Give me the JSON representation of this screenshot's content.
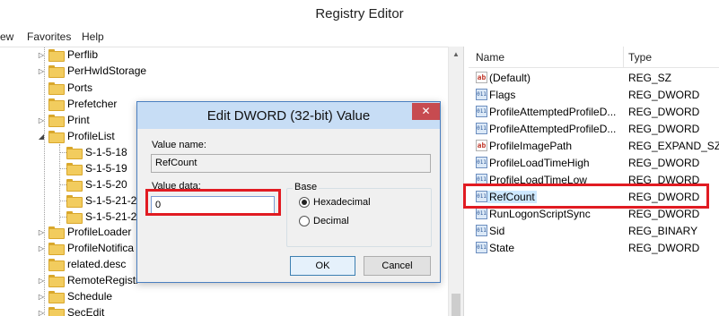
{
  "window": {
    "title": "Registry Editor"
  },
  "menu": {
    "items": [
      "ew",
      "Favorites",
      "Help"
    ]
  },
  "tree": {
    "items": [
      {
        "label": "Perflib",
        "arrow": "▷"
      },
      {
        "label": "PerHwIdStorage",
        "arrow": "▷"
      },
      {
        "label": "Ports",
        "arrow": ""
      },
      {
        "label": "Prefetcher",
        "arrow": ""
      },
      {
        "label": "Print",
        "arrow": "▷"
      },
      {
        "label": "ProfileList",
        "arrow": "◢"
      },
      {
        "label": "S-1-5-18",
        "arrow": ""
      },
      {
        "label": "S-1-5-19",
        "arrow": ""
      },
      {
        "label": "S-1-5-20",
        "arrow": ""
      },
      {
        "label": "S-1-5-21-2",
        "arrow": ""
      },
      {
        "label": "S-1-5-21-2",
        "arrow": ""
      },
      {
        "label": "ProfileLoader",
        "arrow": "▷"
      },
      {
        "label": "ProfileNotifica",
        "arrow": "▷"
      },
      {
        "label": "related.desc",
        "arrow": ""
      },
      {
        "label": "RemoteRegistr",
        "arrow": "▷"
      },
      {
        "label": "Schedule",
        "arrow": "▷"
      },
      {
        "label": "SecEdit",
        "arrow": "▷"
      }
    ]
  },
  "values": {
    "columns": {
      "name": "Name",
      "type": "Type"
    },
    "rows": [
      {
        "name": "(Default)",
        "type": "REG_SZ",
        "icon": "ab"
      },
      {
        "name": "Flags",
        "type": "REG_DWORD",
        "icon": "bin"
      },
      {
        "name": "ProfileAttemptedProfileD...",
        "type": "REG_DWORD",
        "icon": "bin"
      },
      {
        "name": "ProfileAttemptedProfileD...",
        "type": "REG_DWORD",
        "icon": "bin"
      },
      {
        "name": "ProfileImagePath",
        "type": "REG_EXPAND_SZ",
        "icon": "ab"
      },
      {
        "name": "ProfileLoadTimeHigh",
        "type": "REG_DWORD",
        "icon": "bin"
      },
      {
        "name": "ProfileLoadTimeLow",
        "type": "REG_DWORD",
        "icon": "bin"
      },
      {
        "name": "RefCount",
        "type": "REG_DWORD",
        "icon": "bin"
      },
      {
        "name": "RunLogonScriptSync",
        "type": "REG_DWORD",
        "icon": "bin"
      },
      {
        "name": "Sid",
        "type": "REG_BINARY",
        "icon": "bin"
      },
      {
        "name": "State",
        "type": "REG_DWORD",
        "icon": "bin"
      }
    ]
  },
  "dialog": {
    "title": "Edit DWORD (32-bit) Value",
    "close": "✕",
    "value_name_label": "Value name:",
    "value_name": "RefCount",
    "value_data_label": "Value data:",
    "value_data": "0",
    "base_label": "Base",
    "hex_label": "Hexadecimal",
    "dec_label": "Decimal",
    "ok": "OK",
    "cancel": "Cancel"
  },
  "colors": {
    "highlight_box": "#e11b22",
    "dialog_title_bg": "#c7ddf5",
    "close_button": "#c74b50"
  }
}
